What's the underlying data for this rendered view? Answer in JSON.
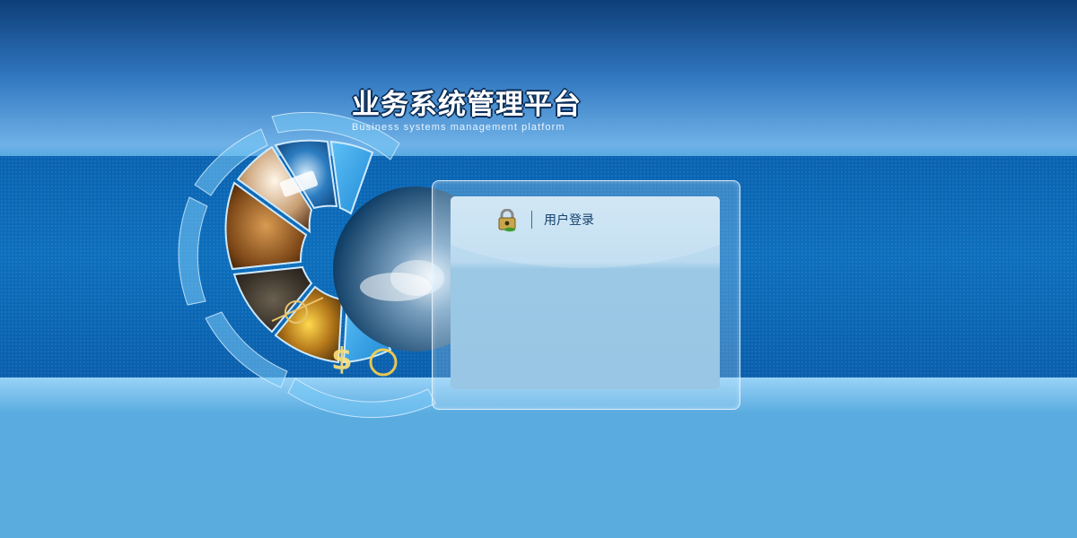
{
  "brand": {
    "title": "业务系统管理平台",
    "subtitle": "Business systems management platform"
  },
  "login": {
    "title": "用户登录",
    "icon": "lock-icon"
  },
  "colors": {
    "band": "#0a63b1",
    "background": "#5aacdf",
    "panel": "#b8d9ef",
    "title_text": "#15426d"
  }
}
